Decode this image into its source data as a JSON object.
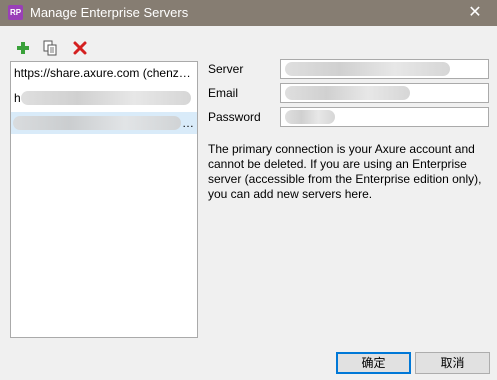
{
  "window": {
    "app_icon_text": "RP",
    "title": "Manage Enterprise Servers",
    "close_glyph": "✕"
  },
  "toolbar": {
    "add_icon": "plus-icon",
    "copy_icon": "copy-icon",
    "delete_icon": "delete-icon",
    "add_color": "#3aa13a",
    "delete_color": "#d42020"
  },
  "server_list": {
    "items": [
      {
        "label": "https://share.axure.com (chenz…"
      },
      {
        "label": "h"
      },
      {
        "label": "…"
      }
    ]
  },
  "form": {
    "server_label": "Server",
    "email_label": "Email",
    "password_label": "Password"
  },
  "description": "The primary connection is your Axure account and cannot be deleted. If you are using an Enterprise server (accessible from the Enterprise edition only), you can add new servers here.",
  "buttons": {
    "ok_label": "确定",
    "cancel_label": "取消"
  },
  "colors": {
    "titlebar": "#867d72",
    "selection": "#d9ebf9",
    "primary_border": "#0078d7"
  }
}
